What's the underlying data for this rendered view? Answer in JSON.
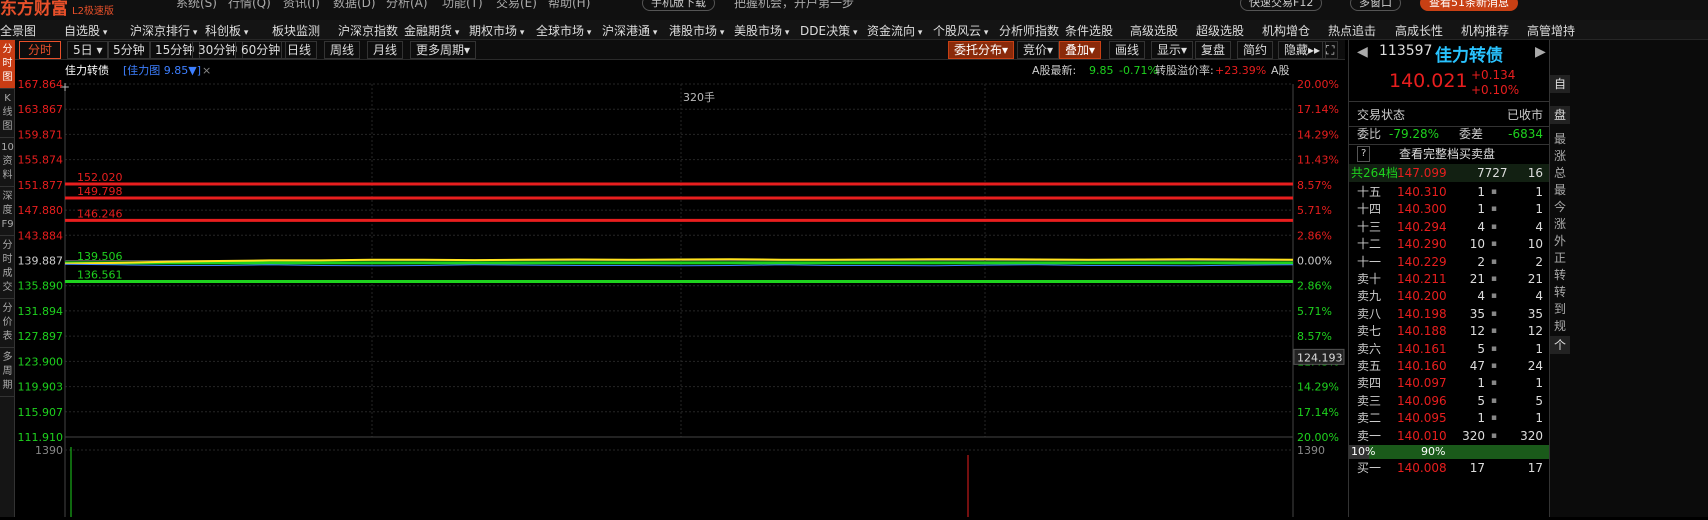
{
  "topbar": {
    "logo": "东方财富",
    "logo_sub": "L2极速版",
    "menus": [
      "系统(S)",
      "行情(Q)",
      "资讯(I)",
      "数据(D)",
      "分析(A)",
      "功能(T)",
      "交易(E)",
      "帮助(H)"
    ],
    "mobile": "手机版下载",
    "slogan": "把握机会，开户第一步",
    "quick_trade": "快速交易F12",
    "window_btn": "多窗口",
    "new_msg": "查看51条新消息"
  },
  "menubar": [
    "全景图",
    "自选股",
    "沪深京排行",
    "科创板",
    "板块监测",
    "沪深京指数",
    "金融期货",
    "期权市场",
    "全球市场",
    "沪深港通",
    "港股市场",
    "美股市场",
    "DDE决策",
    "资金流向",
    "个股风云",
    "分析师指数",
    "条件选股",
    "高级选股",
    "超级选股",
    "机构增仓",
    "热点追击",
    "高成长性",
    "机构推荐",
    "高管增持"
  ],
  "left_strip": [
    {
      "label": "分\n时\n图",
      "active": true
    },
    {
      "label": "K\n线\n图"
    },
    {
      "label": "10\n资\n料"
    },
    {
      "label": "深\n度\nF9"
    },
    {
      "label": "分\n时\n成\n交"
    },
    {
      "label": "分\n价\n表"
    },
    {
      "label": "多\n周\n期"
    }
  ],
  "chart_toolbar": {
    "periods": [
      "分时",
      "5日",
      "5分钟",
      "15分钟",
      "30分钟",
      "60分钟",
      "日线",
      "周线",
      "月线",
      "更多周期"
    ],
    "right": [
      "委托分布",
      "竞价",
      "叠加",
      "画线",
      "显示",
      "复盘",
      "简约",
      "隐藏"
    ]
  },
  "chart": {
    "name": "佳力转债",
    "overlay": "[佳力图 9.85▼]",
    "close": "×",
    "a_share_label": "A股最新:",
    "a_share_price": "9.85",
    "a_share_chg": "-0.71%",
    "premium_label": "转股溢价率:",
    "premium_value": "+23.39%",
    "a_share_tag": "A股",
    "price_ticks": [
      "167.864",
      "163.867",
      "159.871",
      "155.874",
      "151.877",
      "147.880",
      "143.884",
      "139.887",
      "135.890",
      "131.894",
      "127.897",
      "123.900",
      "119.903",
      "115.907",
      "111.910"
    ],
    "pct_ticks": [
      "20.00%",
      "17.14%",
      "14.29%",
      "11.43%",
      "8.57%",
      "5.71%",
      "2.86%",
      "0.00%",
      "2.86%",
      "5.71%",
      "8.57%",
      "11.43%",
      "14.29%",
      "17.14%",
      "20.00%"
    ],
    "levels": [
      {
        "label": "152.020",
        "value": 152.02
      },
      {
        "label": "149.798",
        "value": 149.798
      },
      {
        "label": "146.246",
        "value": 146.246
      },
      {
        "label": "139.506",
        "value": 139.506
      },
      {
        "label": "136.561",
        "value": 136.561
      }
    ],
    "order_label": "320手",
    "cursor_price": "124.193",
    "volume_tick": "1390",
    "colors": {
      "red": "#e81e1e",
      "green": "#1ed21e",
      "yellow": "#ffe21e",
      "blue": "#3d7fff"
    }
  },
  "chart_data": {
    "type": "line",
    "ylim": [
      111.91,
      167.864
    ],
    "xlim": [
      0,
      240
    ],
    "series": [
      {
        "values": [
          139.4,
          139.5,
          139.7,
          139.8,
          139.9,
          139.9,
          140,
          140,
          139.95,
          140,
          140.05,
          140,
          140.05,
          140.1,
          140.02,
          140,
          140.05,
          140.1,
          140.1,
          140.05,
          140.02,
          140.05,
          140.1,
          140.05,
          140
        ]
      },
      {
        "values": [
          139.3,
          139.2,
          139.1,
          139.1,
          139.2,
          139.1,
          139.05,
          139.1,
          139.2,
          139.15,
          139.1,
          139.1,
          139.05,
          139.1,
          139.2,
          139.1,
          139.1,
          139.05,
          139.15,
          139.2,
          139.1,
          139.1,
          139.05,
          139.15,
          139.2
        ]
      }
    ]
  },
  "quote": {
    "code": "113597",
    "name": "佳力转债",
    "price": "140.021",
    "chg": "+0.134",
    "chg_pct": "+0.10%",
    "status_label": "交易状态",
    "status": "已收市",
    "wb_label": "委比",
    "wb": "-79.28%",
    "wc_label": "委差",
    "wc": "-6834",
    "full_book": "查看完整档买卖盘",
    "total_label": "共264档",
    "total_price": "147.099",
    "total_vol1": "7727",
    "total_vol2": "16",
    "asks": [
      {
        "label": "十五",
        "price": "140.310",
        "vol": "1",
        "v2": "1"
      },
      {
        "label": "十四",
        "price": "140.300",
        "vol": "1",
        "v2": "1"
      },
      {
        "label": "十三",
        "price": "140.294",
        "vol": "4",
        "v2": "4"
      },
      {
        "label": "十二",
        "price": "140.290",
        "vol": "10",
        "v2": "10"
      },
      {
        "label": "十一",
        "price": "140.229",
        "vol": "2",
        "v2": "2"
      },
      {
        "label": "卖十",
        "price": "140.211",
        "vol": "21",
        "v2": "21"
      },
      {
        "label": "卖九",
        "price": "140.200",
        "vol": "4",
        "v2": "4"
      },
      {
        "label": "卖八",
        "price": "140.198",
        "vol": "35",
        "v2": "35"
      },
      {
        "label": "卖七",
        "price": "140.188",
        "vol": "12",
        "v2": "12"
      },
      {
        "label": "卖六",
        "price": "140.161",
        "vol": "5",
        "v2": "1"
      },
      {
        "label": "卖五",
        "price": "140.160",
        "vol": "47",
        "v2": "24"
      },
      {
        "label": "卖四",
        "price": "140.097",
        "vol": "1",
        "v2": "1"
      },
      {
        "label": "卖三",
        "price": "140.096",
        "vol": "5",
        "v2": "5"
      },
      {
        "label": "卖二",
        "price": "140.095",
        "vol": "1",
        "v2": "1"
      },
      {
        "label": "卖一",
        "price": "140.010",
        "vol": "320",
        "v2": "320"
      }
    ],
    "ratio_left": "10%",
    "ratio_right": "90%",
    "bid1": {
      "label": "买一",
      "price": "140.008",
      "vol": "17",
      "v2": "17"
    }
  },
  "far_right": {
    "tab": "盘",
    "items": [
      "最",
      "涨",
      "总",
      "最",
      "今",
      "涨",
      "外",
      "正",
      "转",
      "转",
      "到",
      "规"
    ],
    "footer": "个"
  }
}
